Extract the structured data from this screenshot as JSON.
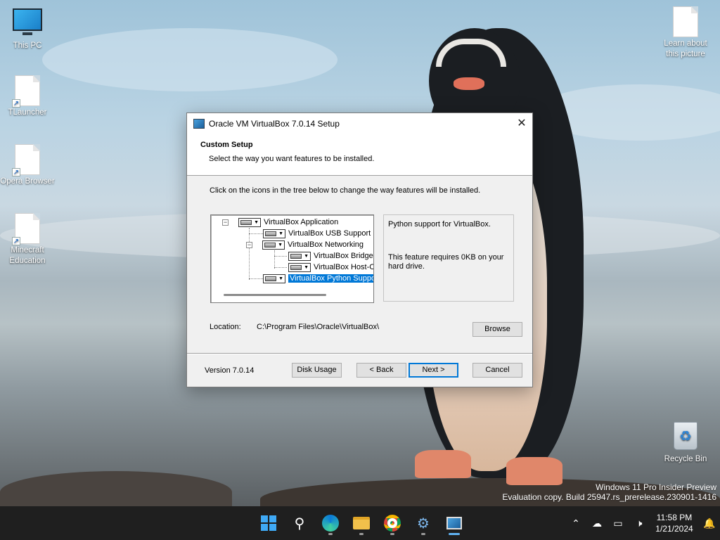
{
  "desktop": {
    "icons_left": [
      {
        "label": "This PC"
      },
      {
        "label": "TLauncher"
      },
      {
        "label": "Opera Browser"
      },
      {
        "label": "Minecraft Education"
      }
    ],
    "icons_right": [
      {
        "label": "Learn about this picture"
      },
      {
        "label": "Recycle Bin"
      }
    ],
    "watermark_line1": "Windows 11 Pro Insider Preview",
    "watermark_line2": "Evaluation copy. Build 25947.rs_prerelease.230901-1416"
  },
  "dialog": {
    "title": "Oracle VM VirtualBox 7.0.14 Setup",
    "close_glyph": "✕",
    "banner_title": "Custom Setup",
    "banner_subtitle": "Select the way you want features to be installed.",
    "instruction": "Click on the icons in the tree below to change the way features will be installed.",
    "tree": [
      {
        "label": "VirtualBox Application",
        "expander": "−"
      },
      {
        "label": "VirtualBox USB Support"
      },
      {
        "label": "VirtualBox Networking",
        "expander": "−"
      },
      {
        "label": "VirtualBox Bridged"
      },
      {
        "label": "VirtualBox Host-C"
      },
      {
        "label": "VirtualBox Python Suppo",
        "selected": true
      }
    ],
    "description_line1": "Python support for VirtualBox.",
    "description_line2": "This feature requires 0KB on your hard drive.",
    "location_label": "Location:",
    "location_path": "C:\\Program Files\\Oracle\\VirtualBox\\",
    "browse_label": "Browse",
    "version": "Version 7.0.14",
    "buttons": {
      "disk_usage": "Disk Usage",
      "back": "< Back",
      "next": "Next >",
      "cancel": "Cancel"
    }
  },
  "taskbar": {
    "time": "11:58 PM",
    "date": "1/21/2024",
    "apps": [
      "start-icon",
      "search-icon",
      "edge-icon",
      "file-explorer-icon",
      "chrome-icon",
      "settings-icon",
      "virtualbox-setup-icon"
    ]
  }
}
